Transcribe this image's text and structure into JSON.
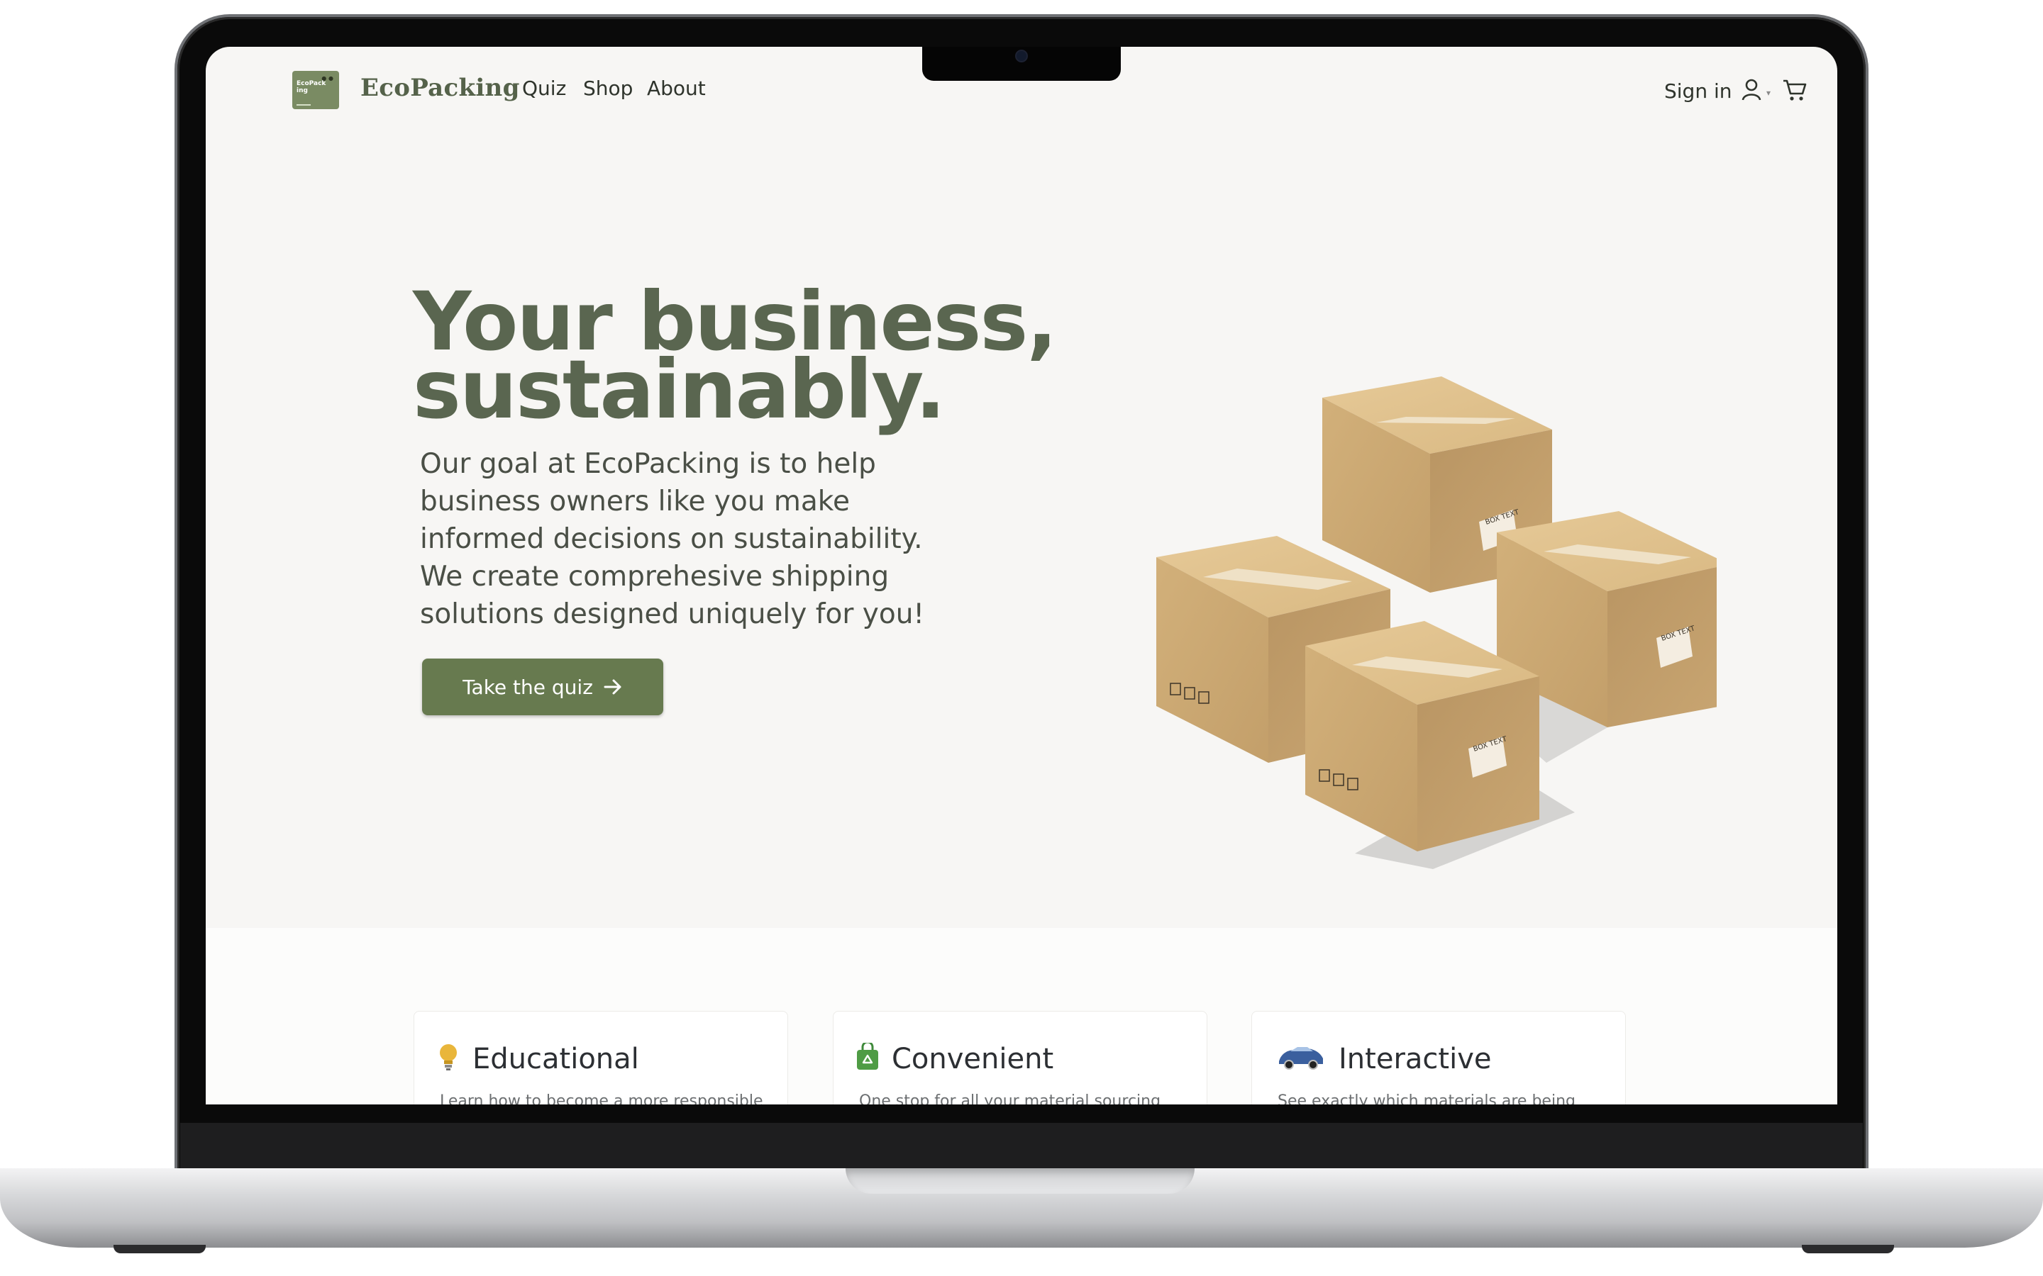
{
  "nav": {
    "brand": "EcoPacking",
    "logo_text": "EcoPack ing",
    "links": [
      "Quiz",
      "Shop",
      "About"
    ],
    "sign_in": "Sign in",
    "icons": [
      "user-icon",
      "chevron-down-icon",
      "cart-icon"
    ]
  },
  "hero": {
    "headline_line1": "Your business,",
    "headline_line2": "sustainably.",
    "intro": "Our goal at EcoPacking is to help business owners like you make informed decisions on sustainability. We create comprehesive shipping solutions designed uniquely for you!",
    "cta_label": "Take the quiz",
    "box_label": "BOX TEXT"
  },
  "features": [
    {
      "title": "Educational",
      "icon": "lightbulb-icon",
      "text": "Learn how to become a more responsible"
    },
    {
      "title": "Convenient",
      "icon": "recycle-bag-icon",
      "text": "One stop for all your material sourcing"
    },
    {
      "title": "Interactive",
      "icon": "car-icon",
      "text": "See exactly which materials are being"
    }
  ],
  "colors": {
    "brand_green": "#677a4f",
    "headline_green": "#5a6650",
    "background": "#f7f6f4"
  }
}
